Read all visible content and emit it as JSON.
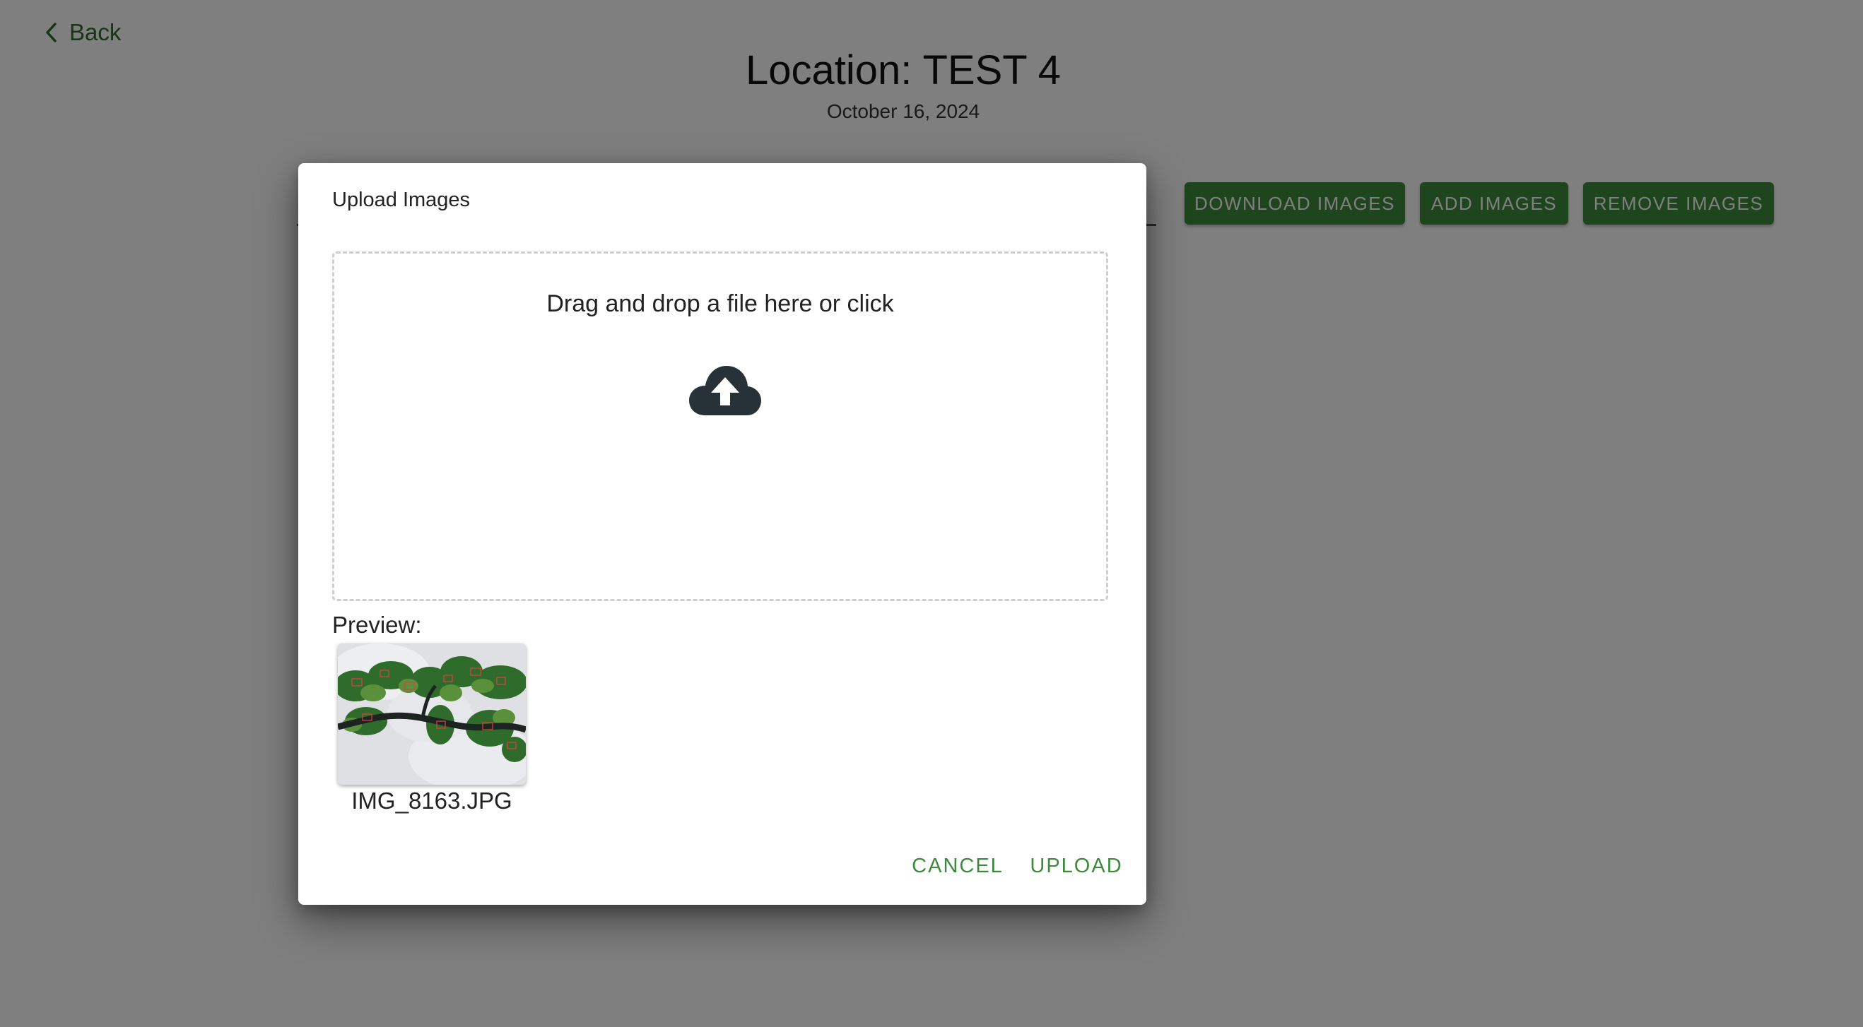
{
  "nav": {
    "back_label": "Back"
  },
  "header": {
    "title": "Location: TEST 4",
    "date": "October 16, 2024"
  },
  "toolbar": {
    "download_label": "DOWNLOAD IMAGES",
    "add_label": "ADD IMAGES",
    "remove_label": "REMOVE IMAGES"
  },
  "dialog": {
    "title": "Upload Images",
    "dropzone_text": "Drag and drop a file here or click",
    "dropzone_icon": "cloud-upload-icon",
    "preview_label": "Preview:",
    "files": [
      {
        "name": "IMG_8163.JPG"
      }
    ],
    "cancel_label": "CANCEL",
    "upload_label": "UPLOAD"
  },
  "colors": {
    "accent": "#3d8a3d",
    "overlay": "rgba(0,0,0,0.5)",
    "icon": "#263238"
  }
}
